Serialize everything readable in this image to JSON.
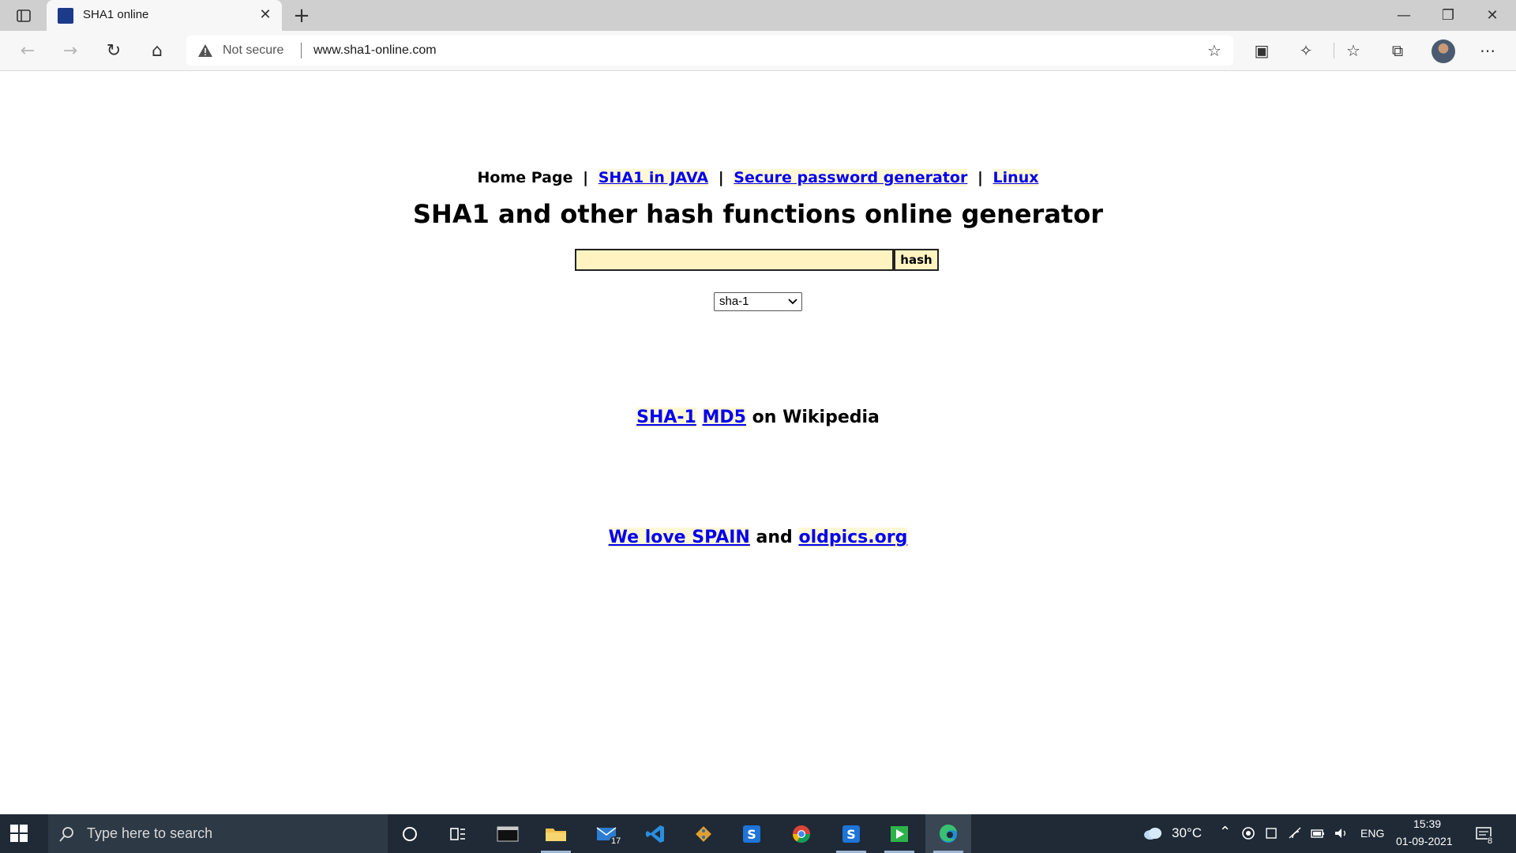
{
  "browser": {
    "tab_title": "SHA1 online",
    "security_label": "Not secure",
    "url": "www.sha1-online.com"
  },
  "page": {
    "nav": {
      "home": "Home Page",
      "separator": "|",
      "link1": "SHA1 in JAVA",
      "link2": "Secure password generator",
      "link3": "Linux"
    },
    "heading": "SHA1 and other hash functions online generator",
    "hash_input_value": "",
    "hash_button": "hash",
    "algorithm_selected": "sha-1",
    "wiki": {
      "link1": "SHA-1",
      "link2": "MD5",
      "suffix": "on Wikipedia"
    },
    "footer": {
      "link1": "We love SPAIN",
      "and": "and",
      "link2": "oldpics.org"
    }
  },
  "taskbar": {
    "search_placeholder": "Type here to search",
    "mail_badge": "17",
    "weather": "30°C",
    "language": "ENG",
    "time": "15:39",
    "date": "01-09-2021",
    "notifications": "8"
  }
}
